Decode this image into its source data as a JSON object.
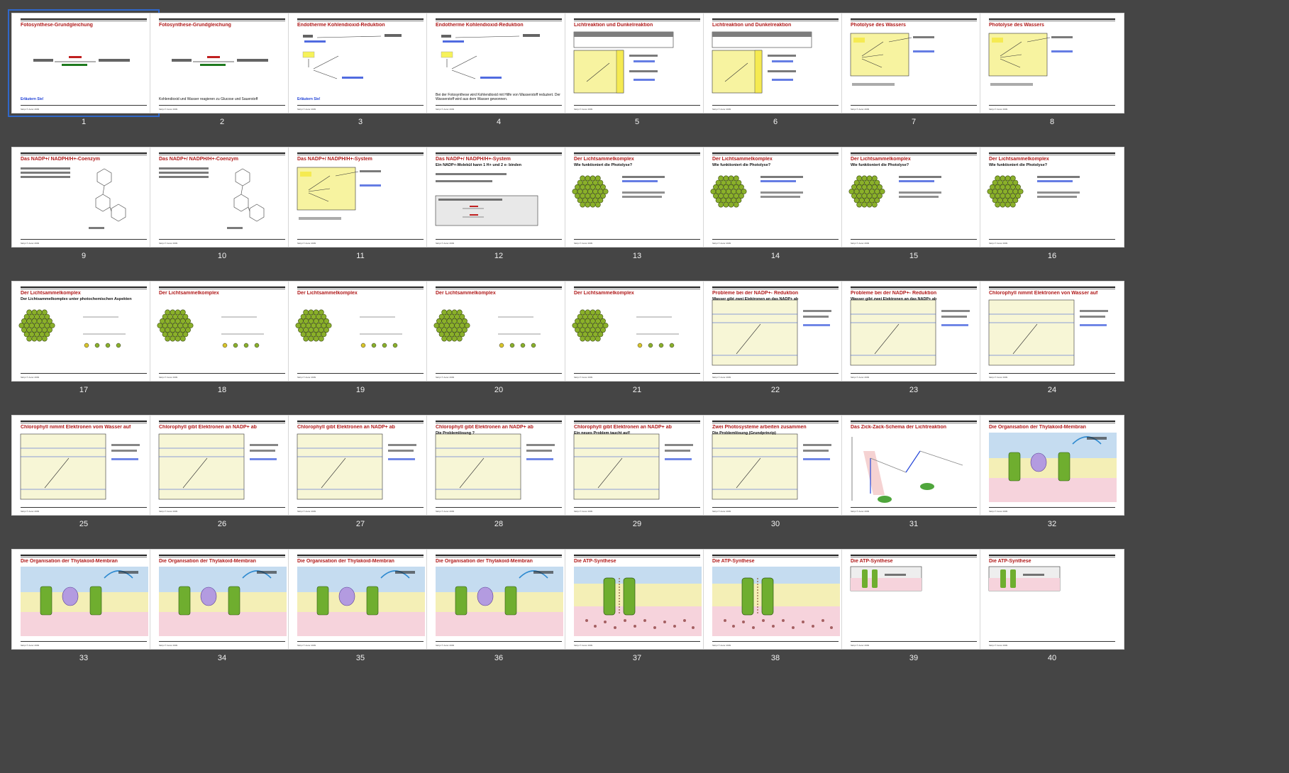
{
  "app": {
    "selected_slide": 1
  },
  "colors": {
    "background": "#454545",
    "title": "#b01a1a",
    "selection": "#2f67c9",
    "note_blue": "#1d3fd6"
  },
  "footer_text": "Skript © Autor 2009",
  "slides": [
    {
      "n": "1",
      "title": "Fotosynthese-Grundgleichung",
      "subtitle": "",
      "note": "Erläutern Sie!",
      "blue": true,
      "art": "equation"
    },
    {
      "n": "2",
      "title": "Fotosynthese-Grundgleichung",
      "subtitle": "",
      "note": "Kohlendioxid und Wasser reagieren zu Glucose und Sauerstoff",
      "blue": false,
      "art": "equation"
    },
    {
      "n": "3",
      "title": "Endotherme Kohlendioxid-Reduktion",
      "subtitle": "",
      "note": "Erläutern Sie!",
      "blue": true,
      "art": "reduction"
    },
    {
      "n": "4",
      "title": "Endotherme Kohlendioxid-Reduktion",
      "subtitle": "",
      "note": "Bei der Fotosynthese wird Kohlendioxid mit Hilfe von Wasserstoff reduziert. Der Wasserstoff wird aus dem Wasser gewonnen.",
      "blue": false,
      "art": "reduction"
    },
    {
      "n": "5",
      "title": "Lichtreaktion und Dunkelreaktion",
      "subtitle": "",
      "note": "",
      "blue": false,
      "art": "lightdark"
    },
    {
      "n": "6",
      "title": "Lichtreaktion und Dunkelreaktion",
      "subtitle": "",
      "note": "",
      "blue": false,
      "art": "lightdark"
    },
    {
      "n": "7",
      "title": "Photolyse des Wassers",
      "subtitle": "",
      "note": "",
      "blue": false,
      "art": "photolysis"
    },
    {
      "n": "8",
      "title": "Photolyse des Wassers",
      "subtitle": "",
      "note": "",
      "blue": false,
      "art": "photolysis"
    },
    {
      "n": "9",
      "title": "Das NADP+/ NADPH/H+-Coenzym",
      "subtitle": "",
      "note": "",
      "blue": false,
      "art": "molecule"
    },
    {
      "n": "10",
      "title": "Das NADP+/ NADPH/H+-Coenzym",
      "subtitle": "",
      "note": "",
      "blue": false,
      "art": "molecule"
    },
    {
      "n": "11",
      "title": "Das NADP+/ NADPH/H+-System",
      "subtitle": "",
      "note": "",
      "blue": false,
      "art": "photolysis"
    },
    {
      "n": "12",
      "title": "Das NADP+/ NADPH/H+-System",
      "subtitle": "Ein NADP+-Molekül kann 1 H+ und 2 e- binden",
      "note": "",
      "blue": false,
      "art": "box"
    },
    {
      "n": "13",
      "title": "Der Lichtsammelkomplex",
      "subtitle": "Wie funktioniert die Photolyse?",
      "note": "",
      "blue": false,
      "art": "hex"
    },
    {
      "n": "14",
      "title": "Der Lichtsammelkomplex",
      "subtitle": "Wie funktioniert die Photolyse?",
      "note": "",
      "blue": false,
      "art": "hex"
    },
    {
      "n": "15",
      "title": "Der Lichtsammelkomplex",
      "subtitle": "Wie funktioniert die Photolyse?",
      "note": "",
      "blue": false,
      "art": "hex"
    },
    {
      "n": "16",
      "title": "Der Lichtsammelkomplex",
      "subtitle": "Wie funktioniert die Photolyse?",
      "note": "",
      "blue": false,
      "art": "hex"
    },
    {
      "n": "17",
      "title": "Der Lichtsammelkomplex",
      "subtitle": "Der Lichtsammelkomplex unter photochemischen Aspekten",
      "note": "",
      "blue": false,
      "art": "levels"
    },
    {
      "n": "18",
      "title": "Der Lichtsammelkomplex",
      "subtitle": "",
      "note": "",
      "blue": false,
      "art": "levels"
    },
    {
      "n": "19",
      "title": "Der Lichtsammelkomplex",
      "subtitle": "",
      "note": "",
      "blue": false,
      "art": "levels"
    },
    {
      "n": "20",
      "title": "Der Lichtsammelkomplex",
      "subtitle": "",
      "note": "",
      "blue": false,
      "art": "levels"
    },
    {
      "n": "21",
      "title": "Der Lichtsammelkomplex",
      "subtitle": "",
      "note": "",
      "blue": false,
      "art": "levels"
    },
    {
      "n": "22",
      "title": "Probleme bei der NADP+- Reduktion",
      "subtitle": "Wasser gibt zwei Elektronen an das NADP+ ab",
      "note": "",
      "blue": false,
      "art": "redox"
    },
    {
      "n": "23",
      "title": "Probleme bei der NADP+- Reduktion",
      "subtitle": "Wasser gibt zwei Elektronen an das NADP+ ab",
      "note": "",
      "blue": false,
      "art": "redox"
    },
    {
      "n": "24",
      "title": "Chlorophyll nimmt Elektronen von Wasser auf",
      "subtitle": "",
      "note": "",
      "blue": false,
      "art": "redox"
    },
    {
      "n": "25",
      "title": "Chlorophyll nimmt Elektronen vom Wasser auf",
      "subtitle": "",
      "note": "",
      "blue": false,
      "art": "redox"
    },
    {
      "n": "26",
      "title": "Chlorophyll gibt Elektronen an NADP+ ab",
      "subtitle": "",
      "note": "",
      "blue": false,
      "art": "redox"
    },
    {
      "n": "27",
      "title": "Chlorophyll gibt Elektronen an NADP+ ab",
      "subtitle": "",
      "note": "",
      "blue": false,
      "art": "redox"
    },
    {
      "n": "28",
      "title": "Chlorophyll gibt Elektronen an NADP+ ab",
      "subtitle": "Die Problemlösung ?",
      "note": "",
      "blue": false,
      "art": "redox"
    },
    {
      "n": "29",
      "title": "Chlorophyll gibt Elektronen an NADP+ ab",
      "subtitle": "Ein neues Problem taucht auf!",
      "note": "",
      "blue": false,
      "art": "redox"
    },
    {
      "n": "30",
      "title": "Zwei Photosysteme arbeiten zusammen",
      "subtitle": "Die Problemlösung (Grundprinzip)",
      "note": "",
      "blue": false,
      "art": "redox"
    },
    {
      "n": "31",
      "title": "Das Zick-Zack-Schema der Lichtreaktion",
      "subtitle": "",
      "note": "",
      "blue": false,
      "art": "zigzag"
    },
    {
      "n": "32",
      "title": "Die Organisation der Thylakoid-Membran",
      "subtitle": "",
      "note": "",
      "blue": false,
      "art": "membrane"
    },
    {
      "n": "33",
      "title": "Die Organisation der Thylakoid-Membran",
      "subtitle": "",
      "note": "",
      "blue": false,
      "art": "membrane"
    },
    {
      "n": "34",
      "title": "Die Organisation der Thylakoid-Membran",
      "subtitle": "",
      "note": "",
      "blue": false,
      "art": "membrane"
    },
    {
      "n": "35",
      "title": "Die Organisation der Thylakoid-Membran",
      "subtitle": "",
      "note": "",
      "blue": false,
      "art": "membrane"
    },
    {
      "n": "36",
      "title": "Die Organisation der Thylakoid-Membran",
      "subtitle": "",
      "note": "",
      "blue": false,
      "art": "membrane"
    },
    {
      "n": "37",
      "title": "Die ATP-Synthese",
      "subtitle": "",
      "note": "",
      "blue": false,
      "art": "atp"
    },
    {
      "n": "38",
      "title": "Die ATP-Synthese",
      "subtitle": "",
      "note": "",
      "blue": false,
      "art": "atp"
    },
    {
      "n": "39",
      "title": "Die ATP-Synthese",
      "subtitle": "",
      "note": "",
      "blue": false,
      "art": "atpsmall"
    },
    {
      "n": "40",
      "title": "Die ATP-Synthese",
      "subtitle": "",
      "note": "",
      "blue": false,
      "art": "atpsmall"
    }
  ]
}
